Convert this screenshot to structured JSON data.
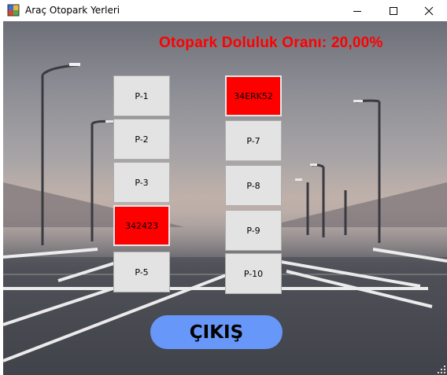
{
  "window": {
    "title": "Araç Otopark Yerleri"
  },
  "occupancy_label": "Otopark Doluluk Oranı: 20,00%",
  "slots": [
    {
      "label": "P-1",
      "occupied": false
    },
    {
      "label": "34ERK52",
      "occupied": true
    },
    {
      "label": "P-2",
      "occupied": false
    },
    {
      "label": "P-7",
      "occupied": false
    },
    {
      "label": "P-3",
      "occupied": false
    },
    {
      "label": "P-8",
      "occupied": false
    },
    {
      "label": "342423",
      "occupied": true
    },
    {
      "label": "P-9",
      "occupied": false
    },
    {
      "label": "P-5",
      "occupied": false
    },
    {
      "label": "P-10",
      "occupied": false
    }
  ],
  "exit_label": "ÇIKIŞ",
  "colors": {
    "occupied": "#ff0000",
    "free": "#e3e3e3",
    "accent": "#6797f8",
    "occupancy_text": "#ff0000"
  },
  "icons": {
    "app": "app-icon",
    "minimize": "minimize-icon",
    "maximize": "maximize-icon",
    "close": "close-icon",
    "grip": "resize-grip-icon"
  }
}
